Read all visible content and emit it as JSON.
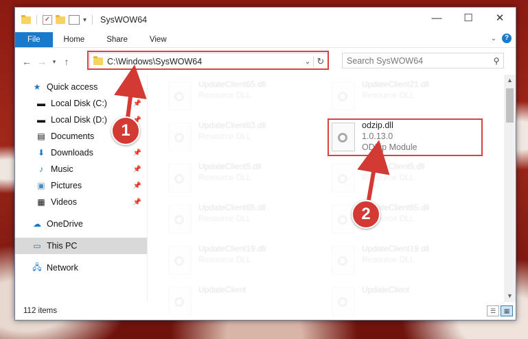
{
  "window": {
    "title": "SysWOW64"
  },
  "ribbon": {
    "tabs": [
      "File",
      "Home",
      "Share",
      "View"
    ]
  },
  "address": {
    "path": "C:\\Windows\\SysWOW64"
  },
  "search": {
    "placeholder": "Search SysWOW64"
  },
  "nav": {
    "items": [
      {
        "label": "Quick access",
        "icon": "star-icon"
      },
      {
        "label": "Local Disk (C:)",
        "icon": "drive-icon",
        "pinned": true
      },
      {
        "label": "Local Disk (D:)",
        "icon": "drive-icon",
        "pinned": true
      },
      {
        "label": "Documents",
        "icon": "documents-icon",
        "pinned": true
      },
      {
        "label": "Downloads",
        "icon": "download-icon",
        "pinned": true
      },
      {
        "label": "Music",
        "icon": "music-icon",
        "pinned": true
      },
      {
        "label": "Pictures",
        "icon": "pictures-icon",
        "pinned": true
      },
      {
        "label": "Videos",
        "icon": "videos-icon",
        "pinned": true
      },
      {
        "label": "OneDrive",
        "icon": "cloud-icon"
      },
      {
        "label": "This PC",
        "icon": "computer-icon",
        "selected": true
      },
      {
        "label": "Network",
        "icon": "network-icon"
      }
    ]
  },
  "files": {
    "left": [
      {
        "name": "UpdateClient65.dll",
        "type": "Resource DLL"
      },
      {
        "name": "UpdateClient63.dll",
        "type": "Resource DLL"
      },
      {
        "name": "UpdateClient5.dll",
        "type": "Resource DLL"
      },
      {
        "name": "UpdateClient65.dll",
        "type": "Resource DLL"
      },
      {
        "name": "UpdateClient19.dll",
        "type": "Resource DLL"
      },
      {
        "name": "UpdateClient",
        "type": ""
      }
    ],
    "right": [
      {
        "name": "UpdateClient21.dll",
        "type": "Resource DLL"
      },
      {
        "name": "odzip.dll",
        "version": "1.0.13.0",
        "type": "ODZip Module",
        "highlighted": true
      },
      {
        "name": "UpdateClient5.dll",
        "type": "Resource DLL"
      },
      {
        "name": "UpdateClient65.dll",
        "type": "Resource DLL"
      },
      {
        "name": "UpdateClient19.dll",
        "type": "Resource DLL"
      },
      {
        "name": "UpdateClient",
        "type": ""
      }
    ]
  },
  "status": {
    "items": "112 items"
  },
  "callouts": [
    "1",
    "2"
  ],
  "colors": {
    "accent": "#1979ca",
    "callout": "#d33a33"
  }
}
